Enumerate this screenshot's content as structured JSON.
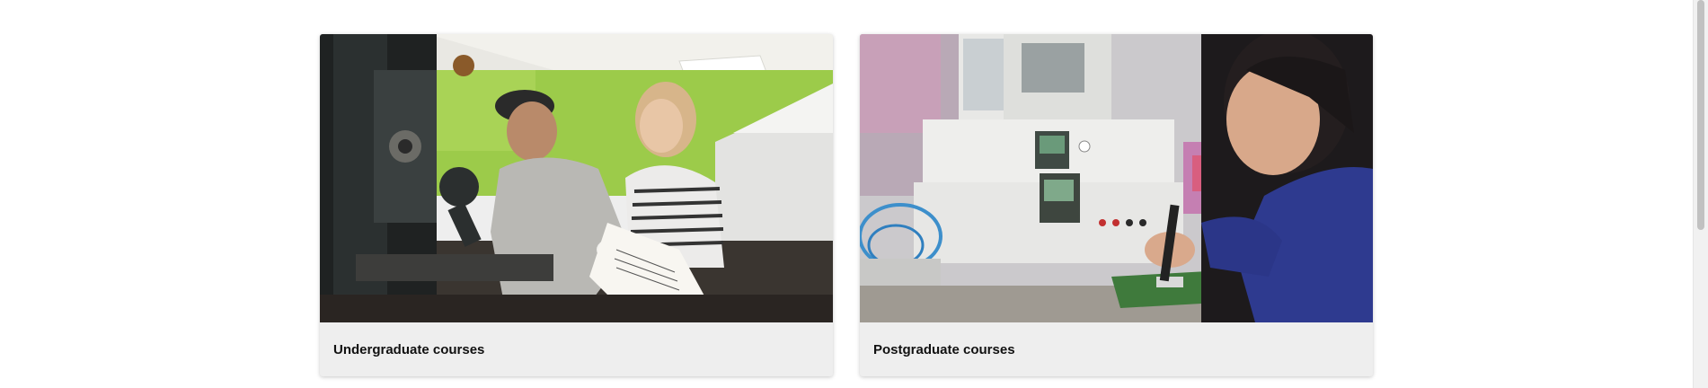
{
  "cards": [
    {
      "label": "Undergraduate courses",
      "image_description": "undergraduate-students-printing-press-photo"
    },
    {
      "label": "Postgraduate courses",
      "image_description": "postgraduate-student-soldering-electronics-photo"
    }
  ]
}
